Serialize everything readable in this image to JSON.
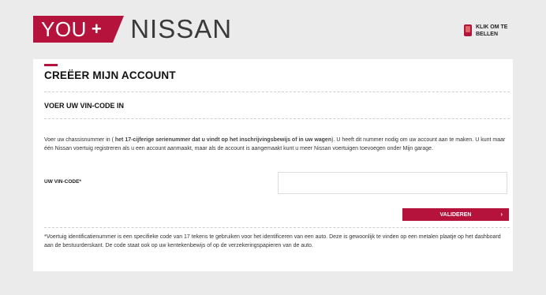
{
  "brand": {
    "logo_you": "YOU",
    "logo_plus": "+",
    "logo_nissan": "NISSAN"
  },
  "call": {
    "label": "KLIK OM TE BELLEN",
    "icon": "phone-icon"
  },
  "page": {
    "title": "CREËER MIJN ACCOUNT",
    "subtitle": "VOER UW VIN-CODE IN",
    "description_start": "Voer uw chassisnummer in ( ",
    "description_highlight": "het 17-cijferige serienummer dat u vindt op het inschrijvingsbewijs of in uw wagen",
    "description_end": "). U heeft dit nummer nodig om uw account aan te maken. U kunt maar één Nissan voertuig registreren als u een account aanmaakt, maar als de account is aangemaakt kunt u meer Nissan voertuigen toevoegen onder Mijn garage."
  },
  "form": {
    "vin_label": "UW VIN-CODE*",
    "vin_value": "",
    "validate_label": "VALIDEREN",
    "validate_chevron": "›"
  },
  "footnote": "*Voertuig identificatienummer is een specifieke code van 17 tekens te gebruiken voor het identificeren van een auto. Deze is gewoonlijk te vinden op een metalen plaatje op het dashboard aan de bestuurderskant. De code staat ook op uw kentekenbewijs of op de verzekeringspapieren van de auto.",
  "colors": {
    "brand_red": "#b5123c",
    "background": "#ebebeb"
  }
}
